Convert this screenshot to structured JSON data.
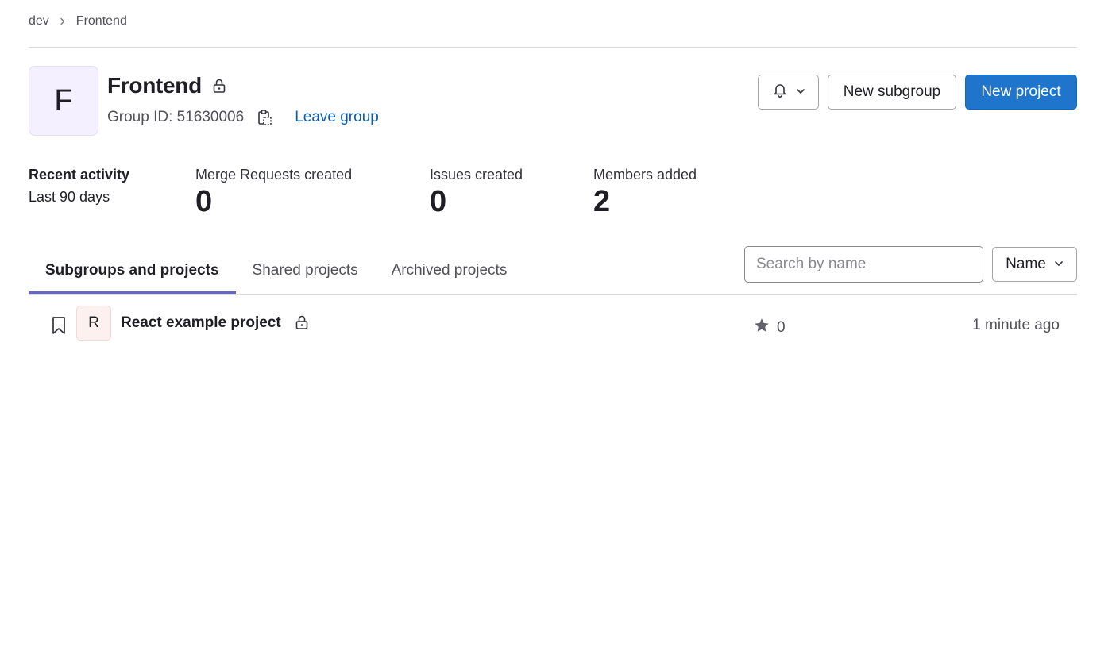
{
  "breadcrumb": {
    "items": [
      "dev",
      "Frontend"
    ]
  },
  "group": {
    "avatar_letter": "F",
    "name": "Frontend",
    "group_id_text": "Group ID: 51630006",
    "leave_label": "Leave group"
  },
  "actions": {
    "notification_icon": "bell-icon",
    "new_subgroup_label": "New subgroup",
    "new_project_label": "New project"
  },
  "activity": {
    "title": "Recent activity",
    "period": "Last 90 days",
    "stats": [
      {
        "label": "Merge Requests created",
        "value": "0"
      },
      {
        "label": "Issues created",
        "value": "0"
      },
      {
        "label": "Members added",
        "value": "2"
      }
    ]
  },
  "tabs": [
    {
      "label": "Subgroups and projects",
      "active": true
    },
    {
      "label": "Shared projects",
      "active": false
    },
    {
      "label": "Archived projects",
      "active": false
    }
  ],
  "search": {
    "placeholder": "Search by name",
    "value": ""
  },
  "sort": {
    "selected": "Name"
  },
  "projects": [
    {
      "avatar_letter": "R",
      "name": "React example project",
      "private": true,
      "stars": "0",
      "updated": "1 minute ago"
    }
  ],
  "colors": {
    "primary_button": "#1f75cb",
    "link": "#0b5cad",
    "tab_indicator": "#6666c4",
    "group_avatar_bg": "#f4f0ff",
    "project_avatar_bg": "#fcf1ef"
  }
}
